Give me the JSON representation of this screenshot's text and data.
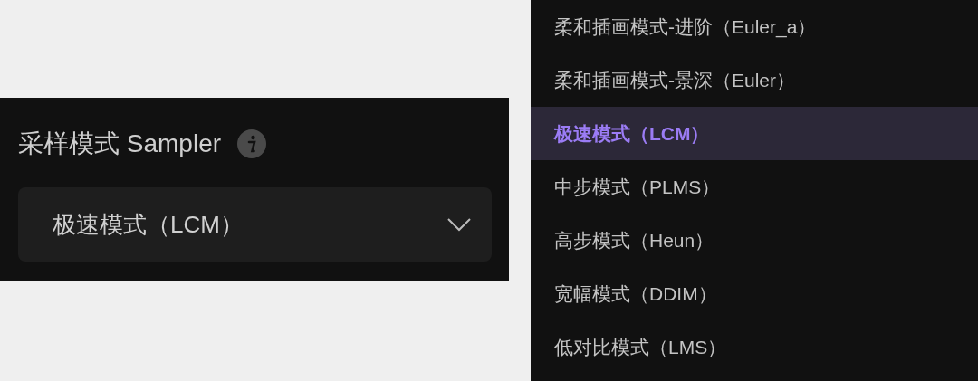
{
  "sampler": {
    "label": "采样模式 Sampler",
    "value": "极速模式（LCM）"
  },
  "dropdown": {
    "options": [
      {
        "label": "柔和插画模式-进阶（Euler_a）",
        "selected": false
      },
      {
        "label": "柔和插画模式-景深（Euler）",
        "selected": false
      },
      {
        "label": "极速模式（LCM）",
        "selected": true
      },
      {
        "label": "中步模式（PLMS）",
        "selected": false
      },
      {
        "label": "高步模式（Heun）",
        "selected": false
      },
      {
        "label": "宽幅模式（DDIM）",
        "selected": false
      },
      {
        "label": "低对比模式（LMS）",
        "selected": false
      }
    ]
  }
}
